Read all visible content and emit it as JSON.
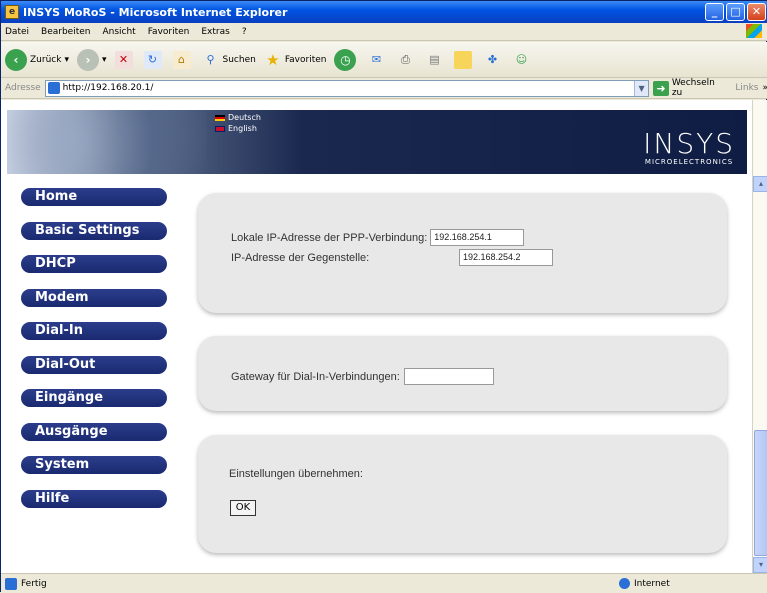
{
  "window": {
    "title": "INSYS MoRoS - Microsoft Internet Explorer",
    "min": "_",
    "max": "□",
    "close": "✕"
  },
  "menu": [
    "Datei",
    "Bearbeiten",
    "Ansicht",
    "Favoriten",
    "Extras",
    "?"
  ],
  "toolbar": {
    "back": "Zurück",
    "back_arrow": "▾",
    "forward_arrow": "▾",
    "search": "Suchen",
    "favorites": "Favoriten"
  },
  "address": {
    "label": "Adresse",
    "url": "http://192.168.20.1/",
    "go": "Wechseln zu",
    "links": "Links",
    "more": "»"
  },
  "banner": {
    "lang_de": "Deutsch",
    "lang_en": "English",
    "brand": "INSYS",
    "brand_sub": "MICROELECTRONICS"
  },
  "nav": [
    "Home",
    "Basic Settings",
    "DHCP",
    "Modem",
    "Dial-In",
    "Dial-Out",
    "Eingänge",
    "Ausgänge",
    "System",
    "Hilfe"
  ],
  "panel1": {
    "local_ip_label": "Lokale IP-Adresse der PPP-Verbindung:",
    "local_ip_value": "192.168.254.1",
    "remote_ip_label": "IP-Adresse der Gegenstelle:",
    "remote_ip_value": "192.168.254.2"
  },
  "panel2": {
    "gateway_label": "Gateway für Dial-In-Verbindungen:",
    "gateway_value": ""
  },
  "panel3": {
    "apply_label": "Einstellungen übernehmen:",
    "ok": "OK"
  },
  "scroll": {
    "up": "▴",
    "down": "▾",
    "thumb_position_fraction": 0.82
  },
  "status": {
    "text": "Fertig",
    "zone": "Internet"
  }
}
